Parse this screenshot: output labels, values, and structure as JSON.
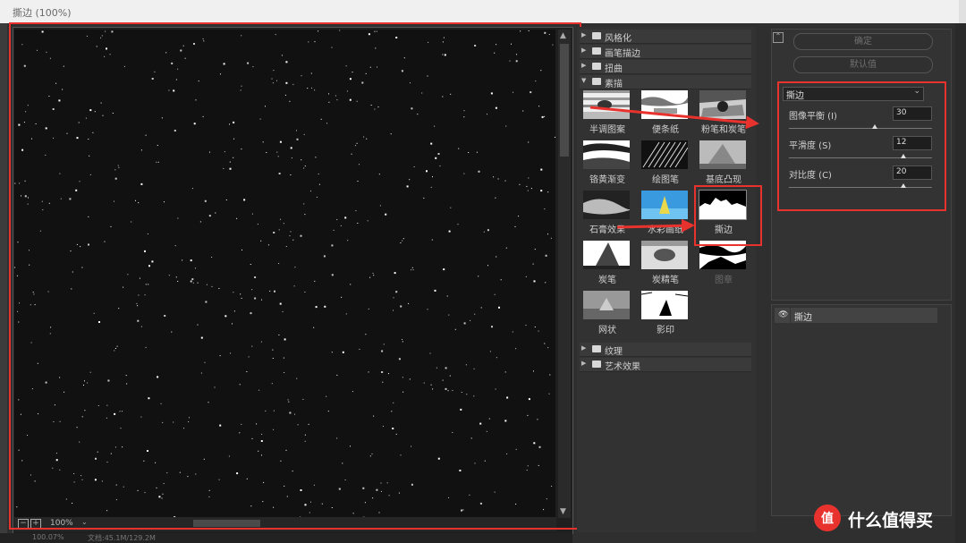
{
  "window": {
    "title": "撕边 (100%)"
  },
  "preview": {
    "zoom": "100%"
  },
  "status": {
    "zoom": "100.07%",
    "doc": "文档:45.1M/129.2M"
  },
  "gallery": {
    "categories_top": [
      "风格化",
      "画笔描边",
      "扭曲",
      "素描"
    ],
    "categories_bottom": [
      "纹理",
      "艺术效果"
    ],
    "filters": [
      {
        "label": "半调图案"
      },
      {
        "label": "便条纸"
      },
      {
        "label": "粉笔和炭笔"
      },
      {
        "label": "铬黄渐变"
      },
      {
        "label": "绘图笔"
      },
      {
        "label": "基底凸现"
      },
      {
        "label": "石膏效果"
      },
      {
        "label": "水彩画纸"
      },
      {
        "label": "撕边"
      },
      {
        "label": "炭笔"
      },
      {
        "label": "炭精笔"
      },
      {
        "label": "图章"
      },
      {
        "label": "网状"
      },
      {
        "label": "影印"
      }
    ],
    "selected_filter": "撕边"
  },
  "actions": {
    "ok": "确定",
    "default": "默认值"
  },
  "settings": {
    "filter_select": "撕边",
    "params": [
      {
        "label": "图像平衡 (I)",
        "value": "30",
        "fraction": 0.6
      },
      {
        "label": "平滑度 (S)",
        "value": "12",
        "fraction": 0.8
      },
      {
        "label": "对比度 (C)",
        "value": "20",
        "fraction": 0.8
      }
    ]
  },
  "layers": {
    "items": [
      {
        "name": "撕边",
        "visible": true
      }
    ]
  },
  "watermark": {
    "icon_text": "值",
    "text": "什么值得买"
  },
  "colors": {
    "highlight": "#e8322e",
    "panel": "#333333",
    "canvas": "#111111"
  }
}
